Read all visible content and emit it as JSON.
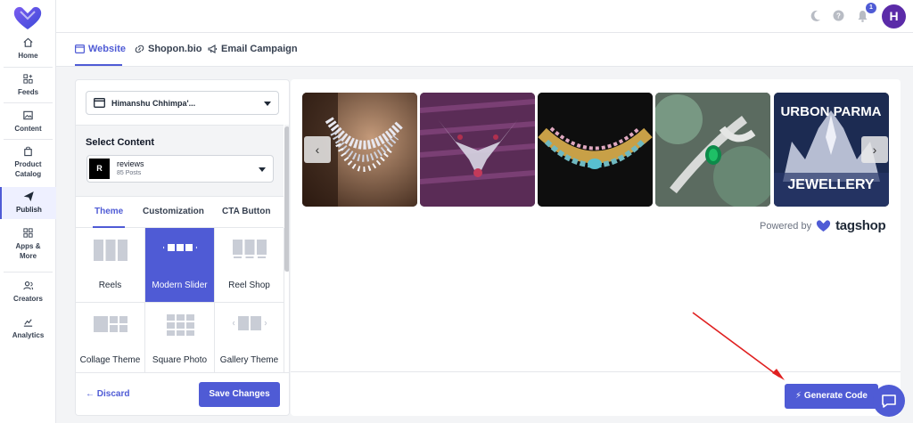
{
  "sidebar": {
    "items": [
      {
        "label": "Home",
        "icon": "home-icon"
      },
      {
        "label": "Feeds",
        "icon": "grid-plus-icon"
      },
      {
        "label": "Content",
        "icon": "image-icon"
      },
      {
        "label": "Product Catalog",
        "icon": "bag-icon"
      },
      {
        "label": "Publish",
        "icon": "send-icon"
      },
      {
        "label": "Apps & More",
        "icon": "apps-icon"
      },
      {
        "label": "Creators",
        "icon": "users-icon"
      },
      {
        "label": "Analytics",
        "icon": "chart-icon"
      }
    ]
  },
  "topbar": {
    "notification_count": "1",
    "avatar_initial": "H"
  },
  "tabs": [
    {
      "label": "Website"
    },
    {
      "label": "Shopon.bio"
    },
    {
      "label": "Email Campaign"
    }
  ],
  "left": {
    "account": "Himanshu Chhimpa'...",
    "select_content_title": "Select Content",
    "content": {
      "initial": "R",
      "name": "reviews",
      "posts": "85 Posts"
    },
    "theme_tabs": [
      "Theme",
      "Customization",
      "CTA Button"
    ],
    "themes": [
      "Reels",
      "Modern Slider",
      "Reel Shop",
      "Collage Theme",
      "Square Photo",
      "Gallery Theme"
    ],
    "discard_label": "Discard",
    "save_label": "Save Changes"
  },
  "right": {
    "powered_by": "Powered by",
    "brand": "tagshop",
    "slide5_text_top": "URBON PARMA",
    "slide5_text_bottom": "JEWELLERY",
    "generate_label": "Generate Code"
  },
  "colors": {
    "accent": "#4f5bd5",
    "avatar": "#5b2ba8"
  }
}
